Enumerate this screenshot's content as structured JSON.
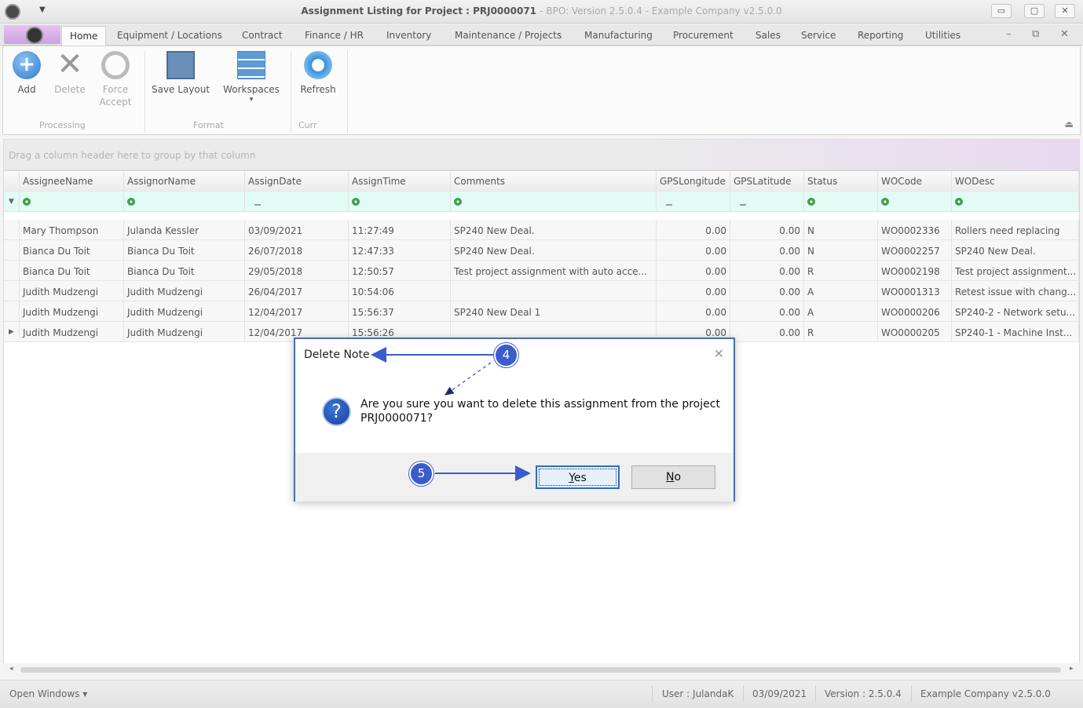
{
  "window": {
    "title_main": "Assignment Listing for Project : PRJ0000071",
    "title_sub": "- BPO: Version 2.5.0.4 - Example Company v2.5.0.0",
    "minimize": "▭",
    "maximize": "▢",
    "close": "✕"
  },
  "tabs": [
    "Home",
    "Equipment / Locations",
    "Contract",
    "Finance / HR",
    "Inventory",
    "Maintenance / Projects",
    "Manufacturing",
    "Procurement",
    "Sales",
    "Service",
    "Reporting",
    "Utilities"
  ],
  "tab_controls": {
    "minimize": "–",
    "restore": "⧉",
    "close": "✕"
  },
  "ribbon": {
    "add": "Add",
    "delete": "Delete",
    "force": "Force",
    "accept": "Accept",
    "save_layout": "Save Layout",
    "workspaces": "Workspaces",
    "refresh": "Refresh",
    "group_processing": "Processing",
    "group_format": "Format",
    "group_curr": "Curr",
    "add_glyph": "+",
    "delete_glyph": "✕",
    "workspaces_caret": "▾",
    "corner_glyph": "⏏"
  },
  "group_panel_text": "Drag a column header here to group by that column",
  "grid": {
    "columns": [
      "AssigneeName",
      "AssignorName",
      "AssignDate",
      "AssignTime",
      "Comments",
      "GPSLongitude",
      "GPSLatitude",
      "Status",
      "WOCode",
      "WODesc"
    ],
    "filter_indicator": "▼",
    "row_indicator": "▶",
    "rows": [
      [
        "Mary Thompson",
        "Julanda Kessler",
        "03/09/2021",
        "11:27:49",
        "SP240 New Deal.",
        "0.00",
        "0.00",
        "N",
        "WO0002336",
        "Rollers need replacing"
      ],
      [
        "Bianca Du Toit",
        "Bianca Du Toit",
        "26/07/2018",
        "12:47:33",
        "SP240 New Deal.",
        "0.00",
        "0.00",
        "N",
        "WO0002257",
        "SP240 New Deal."
      ],
      [
        "Bianca Du Toit",
        "Bianca Du Toit",
        "29/05/2018",
        "12:50:57",
        "Test project assignment with auto acce...",
        "0.00",
        "0.00",
        "R",
        "WO0002198",
        "Test project assignment..."
      ],
      [
        "Judith Mudzengi",
        "Judith Mudzengi",
        "26/04/2017",
        "10:54:06",
        "",
        "0.00",
        "0.00",
        "A",
        "WO0001313",
        "Retest issue with chang..."
      ],
      [
        "Judith Mudzengi",
        "Judith Mudzengi",
        "12/04/2017",
        "15:56:37",
        "SP240 New Deal 1",
        "0.00",
        "0.00",
        "A",
        "WO0000206",
        "SP240-2 - Network setu..."
      ],
      [
        "Judith Mudzengi",
        "Judith Mudzengi",
        "12/04/2017",
        "15:56:26",
        "",
        "0.00",
        "0.00",
        "R",
        "WO0000205",
        "SP240-1 - Machine Inst..."
      ]
    ]
  },
  "scroll": {
    "left": "◂",
    "right": "▸"
  },
  "status": {
    "open_windows": "Open Windows ▾",
    "user": "User : JulandaK",
    "date": "03/09/2021",
    "version": "Version : 2.5.0.4",
    "company": "Example Company v2.5.0.0"
  },
  "dialog": {
    "title": "Delete Note",
    "close_glyph": "✕",
    "question_glyph": "?",
    "message": "Are you sure you want to delete this assignment from the project PRJ0000071?",
    "yes_underline": "Y",
    "yes_rest": "es",
    "no_underline": "N",
    "no_rest": "o"
  },
  "annotations": {
    "marker_4": "4",
    "marker_5": "5"
  },
  "colors": {
    "accent": "#3a5ccc",
    "dialog_border": "#4a6fa8",
    "filter_row": "#e3fbf5"
  }
}
